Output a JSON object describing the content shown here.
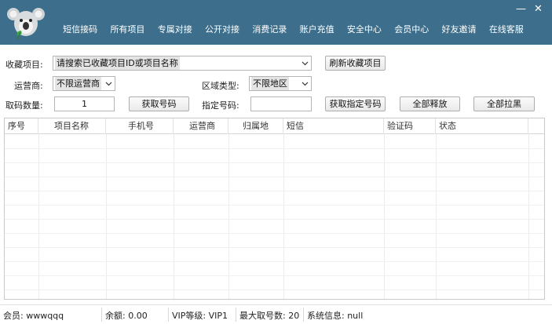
{
  "nav": [
    "短信接码",
    "所有项目",
    "专属对接",
    "公开对接",
    "消费记录",
    "账户充值",
    "安全中心",
    "会员中心",
    "好友邀请",
    "在线客服"
  ],
  "window": {
    "minimize": "—",
    "close": "✕"
  },
  "form": {
    "fav_label": "收藏项目:",
    "fav_value": "请搜索已收藏项目ID或项目名称",
    "refresh_button": "刷新收藏项目",
    "carrier_label": "运营商:",
    "carrier_value": "不限运营商",
    "region_label": "区域类型:",
    "region_value": "不限地区",
    "count_label": "取码数量:",
    "count_value": "1",
    "get_button": "获取号码",
    "specify_label": "指定号码:",
    "specify_value": "",
    "get_specified_button": "获取指定号码",
    "release_all_button": "全部释放",
    "block_all_button": "全部拉黑"
  },
  "table": {
    "columns": [
      "序号",
      "项目名称",
      "手机号",
      "运营商",
      "归属地",
      "短信",
      "验证码",
      "状态"
    ],
    "rows": []
  },
  "status": {
    "member": "会员:  wwwqqq",
    "balance": "余额:  0.00",
    "vip": "VIP等级:  VIP1",
    "max": "最大取号数:  20",
    "sysinfo": "系统信息:  null"
  },
  "colors": {
    "header": "#3d6f8c"
  }
}
